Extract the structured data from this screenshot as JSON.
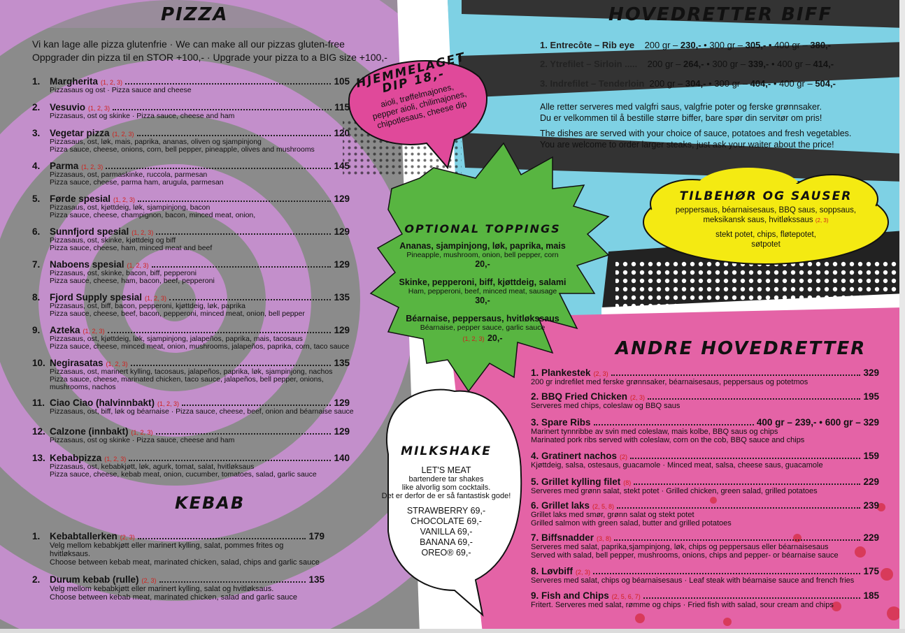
{
  "colors": {
    "purple": "#c38fcb",
    "grey": "#8b8b8b",
    "pink": "#e463a6",
    "blue": "#7ed1e4",
    "green": "#58b541",
    "yellow": "#f4ea12",
    "dip": "#e0499a",
    "alergen": "#d0201c"
  },
  "pizza": {
    "title": "PIZZA",
    "intro1": "Vi kan lage alle pizza glutenfrie · We can make all our pizzas gluten-free",
    "intro2": "Oppgrader din pizza til en STOR +100,- · Upgrade your pizza to a BIG size +100,-",
    "items": [
      {
        "num": "1.",
        "name": "Margherita",
        "al": "(1, 2, 3)",
        "price": "105",
        "d1": "Pizzasaus og ost · Pizza sauce and cheese",
        "d2": "",
        "d3": ""
      },
      {
        "num": "2.",
        "name": "Vesuvio",
        "al": "(1, 2, 3)",
        "price": "115",
        "d1": "Pizzasaus, ost og skinke · Pizza sauce, cheese and ham",
        "d2": "",
        "d3": ""
      },
      {
        "num": "3.",
        "name": "Vegetar pizza",
        "al": "(1, 2, 3)",
        "price": "120",
        "d1": "Pizzasaus, ost, løk, mais, paprika, ananas, oliven og sjampinjong",
        "d2": "Pizza sauce, cheese, onions, corn, bell pepper, pineapple, olives and mushrooms",
        "d3": ""
      },
      {
        "num": "4.",
        "name": "Parma",
        "al": "(1, 2, 3)",
        "price": "145",
        "d1": "Pizzasaus, ost, parmaskinke, ruccola, parmesan",
        "d2": "Pizza sauce, cheese, parma ham, arugula, parmesan",
        "d3": ""
      },
      {
        "num": "5.",
        "name": "Førde spesial",
        "al": "(1, 2, 3)",
        "price": "129",
        "d1": "Pizzasaus, ost, kjøttdeig, løk, sjampinjong, bacon",
        "d2": "Pizza sauce, cheese, champignon, bacon, minced meat, onion,",
        "d3": ""
      },
      {
        "num": "6.",
        "name": "Sunnfjord spesial",
        "al": "(1, 2, 3)",
        "price": "129",
        "d1": "Pizzasaus, ost, skinke, kjøttdeig og biff",
        "d2": "Pizza sauce, cheese, ham, minced meat and beef",
        "d3": ""
      },
      {
        "num": "7.",
        "name": "Naboens spesial",
        "al": "(1, 2, 3)",
        "price": "129",
        "d1": "Pizzasaus, ost, skinke, bacon, biff, pepperoni",
        "d2": "Pizza sauce, cheese, ham, bacon, beef, pepperoni",
        "d3": ""
      },
      {
        "num": "8.",
        "name": "Fjord Supply spesial",
        "al": "(1, 2, 3)",
        "price": "135",
        "d1": "Pizzasaus, ost, biff, bacon, pepperoni, kjøttdeig, løk, paprika",
        "d2": "Pizza sauce, cheese, beef, bacon, pepperoni, minced meat, onion, bell pepper",
        "d3": ""
      },
      {
        "num": "9.",
        "name": "Azteka",
        "al": "(1, 2, 3)",
        "price": "129",
        "d1": "Pizzasaus, ost, kjøttdeig, løk, sjampinjong, jalapeños, paprika, mais, tacosaus",
        "d2": "Pizza sauce, cheese, minced meat, onion, mushrooms, jalapeños, paprika, corn, taco sauce",
        "d3": ""
      },
      {
        "num": "10.",
        "name": "Negirasatas",
        "al": "(1, 2, 3)",
        "price": "135",
        "d1": "Pizzasaus, ost, marinert kylling, tacosaus, jalapeños, paprika, løk, sjampinjong, nachos",
        "d2": "Pizza sauce, cheese, marinated chicken, taco sauce, jalapeños, bell pepper, onions,",
        "d3": "mushrooms, nachos"
      },
      {
        "num": "11.",
        "name": "Ciao Ciao (halvinnbakt)",
        "al": "(1, 2, 3)",
        "price": "129",
        "d1": "Pizzasaus, ost, biff, løk og béarnaise · Pizza sauce, cheese, beef, onion and béarnaise sauce",
        "d2": "",
        "d3": ""
      },
      {
        "num": "12.",
        "name": "Calzone (innbakt)",
        "al": "(1, 2, 3)",
        "price": "129",
        "d1": "Pizzasaus, ost og skinke · Pizza sauce, cheese and ham",
        "d2": "",
        "d3": ""
      },
      {
        "num": "13.",
        "name": "Kebabpizza",
        "al": "(1, 2, 3)",
        "price": "140",
        "d1": "Pizzasaus, ost, kebabkjøtt, løk, agurk, tomat, salat, hvitløksaus",
        "d2": "Pizza sauce, cheese, kebab meat, onion, cucumber, tomatoes, salad, garlic sauce",
        "d3": ""
      }
    ]
  },
  "kebab": {
    "title": "KEBAB",
    "items": [
      {
        "num": "1.",
        "name": "Kebabtallerken",
        "al": "(2, 3)",
        "price": "179",
        "d1": "Velg mellom kebabkjøtt eller marinert kylling, salat, pommes frites og hvitløksaus.",
        "d2": "Choose between kebab meat, marinated chicken, salad, chips and garlic sauce"
      },
      {
        "num": "2.",
        "name": "Durum kebab (rulle)",
        "al": "(2, 3)",
        "price": "135",
        "d1": "Velg mellom kebabkjøtt eller marinert kylling, salat og hvitløksaus.",
        "d2": "Choose between kebab meat, marinated chicken, salad and garlic sauce"
      }
    ]
  },
  "biff": {
    "title": "HOVEDRETTER BIFF",
    "rows": [
      {
        "label": "1. Entrecôte – Rib eye",
        "p1": "200 gr – ",
        "v1": "230,-",
        "p2": " • 300 gr – ",
        "v2": "305,-",
        "p3": " • 400 gr – ",
        "v3": "380,-"
      },
      {
        "label": "2. Ytrefilet – Sirloin .....",
        "p1": "200 gr – ",
        "v1": "264,-",
        "p2": " • 300 gr – ",
        "v2": "339,-",
        "p3": " • 400 gr – ",
        "v3": "414,-"
      },
      {
        "label": "3. Indrefilet – Tenderloin",
        "p1": "200 gr – ",
        "v1": "304,-",
        "p2": " • 300 gr – ",
        "v2": "404,-",
        "p3": " • 400 gr – ",
        "v3": "504,-"
      }
    ],
    "note1": "Alle retter serveres med valgfri saus, valgfrie poter og ferske grønnsaker.",
    "note2": "Du er velkommen til å  bestille større biffer, bare spør din servitør om pris!",
    "note3": "The dishes are served with your choice of sauce, potatoes and fresh vegetables.",
    "note4": "You are welcome to order larger steaks, just ask your waiter about the price!"
  },
  "dip": {
    "title1": "HJEMMELAGET",
    "title2": "DIP 18,-",
    "l1": "aioli, trøffelmajones,",
    "l2": "pepper aioli, chilimajones,",
    "l3": "chipotlesaus, cheese dip"
  },
  "toppings": {
    "title": "OPTIONAL TOPPINGS",
    "g1a": "Ananas, sjampinjong, løk, paprika, mais",
    "g1b": "Pineapple, mushroom, onion, bell pepper, corn",
    "g1p": "20,-",
    "g2a": "Skinke, pepperoni, biff, kjøttdeig, salami",
    "g2b": "Ham, pepperoni, beef, minced meat, sausage",
    "g2p": "30,-",
    "g3a": "Béarnaise, peppersaus, hvitløkssaus",
    "g3b": "Béarnaise, pepper sauce, garlic sauce",
    "g3al": "(1, 2, 3)",
    "g3p": "20,-"
  },
  "tilbehor": {
    "title": "TILBEHØR OG SAUSER",
    "l1": "peppersaus, béarnaisesaus, BBQ saus, soppsaus,",
    "l2": "meksikansk saus, hvitløkssaus",
    "al": "(2, 3)",
    "l3": "stekt potet, chips, fløtepotet,",
    "l4": "søtpotet"
  },
  "milkshake": {
    "title": "MILKSHAKE",
    "l1": "LET'S MEAT",
    "l2": "bartendere tar shakes",
    "l3": "like alvorlig som cocktails.",
    "l4": "Det er derfor de er så fantastisk gode!",
    "flavors": [
      "STRAWBERRY 69,-",
      "CHOCOLATE 69,-",
      "VANILLA 69,-",
      "BANANA 69,-",
      "OREO® 69,-"
    ]
  },
  "andre": {
    "title": "ANDRE HOVEDRETTER",
    "items": [
      {
        "name": "1. Plankestek",
        "al": "(2, 3)",
        "price": "329",
        "d1": "200 gr indrefilet med ferske grønnsaker, béarnaisesaus, peppersaus og potetmos",
        "d2": ""
      },
      {
        "name": "2. BBQ Fried Chicken",
        "al": "(2, 3)",
        "price": "195",
        "d1": "Serveres med chips, coleslaw og BBQ saus",
        "d2": ""
      },
      {
        "name": "3. Spare Ribs",
        "al": "",
        "price": "400 gr – 239,- •  600 gr – 329",
        "d1": "Marinert tynnribbe av svin med coleslaw, mais kolbe, BBQ saus og chips",
        "d2": "Marinated pork ribs served with coleslaw, corn on the cob, BBQ sauce and chips"
      },
      {
        "name": "4. Gratinert nachos",
        "al": "(2)",
        "price": "159",
        "d1": "Kjøttdeig, salsa, ostesaus, guacamole · Minced meat, salsa, cheese saus, guacamole",
        "d2": ""
      },
      {
        "name": "5. Grillet kylling filet",
        "al": "(8)",
        "price": "229",
        "d1": "Serveres med grønn salat, stekt potet · Grilled chicken, green salad, grilled potatoes",
        "d2": ""
      },
      {
        "name": "6. Grillet laks",
        "al": "(2, 5, 8)",
        "price": "239",
        "d1": "Grillet laks med smør, grønn salat og stekt potet",
        "d2": "Grilled salmon with green salad, butter and grilled potatoes"
      },
      {
        "name": "7. Biffsnadder",
        "al": "(3, 8)",
        "price": "229",
        "d1": "Serveres med salat, paprika,sjampinjong, løk, chips og peppersaus eller béarnaisesaus",
        "d2": "Served with salad, bell pepper, mushrooms, onions, chips and pepper- or béarnaise sauce"
      },
      {
        "name": "8. Løvbiff",
        "al": "(2, 3)",
        "price": "175",
        "d1": "Serveres med salat, chips og béarnaisesaus · Leaf steak with béarnaise sauce and french fries",
        "d2": ""
      },
      {
        "name": "9. Fish and Chips",
        "al": "(2, 5, 6, 7)",
        "price": "185",
        "d1": "Fritert. Serveres med salat, rømme og chips · Fried fish with salad, sour cream and chips",
        "d2": ""
      }
    ]
  }
}
